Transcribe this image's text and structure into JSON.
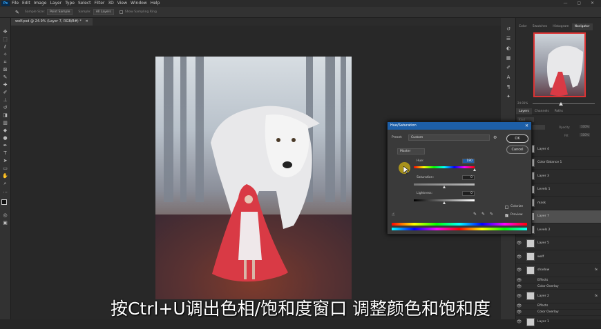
{
  "menubar": {
    "logo": "Ps",
    "items": [
      "File",
      "Edit",
      "Image",
      "Layer",
      "Type",
      "Select",
      "Filter",
      "3D",
      "View",
      "Window",
      "Help"
    ],
    "window_controls": "— ▢ ✕"
  },
  "options_bar": {
    "sample_size_label": "Sample Size:",
    "sample_size_value": "Point Sample",
    "sample_label": "Sample:",
    "sample_value": "All Layers",
    "show_ring": "Show Sampling Ring"
  },
  "document_tab": {
    "title": "wolf.psd @ 24.9% (Layer 7, RGB/8#) *",
    "close": "✕"
  },
  "panel_tabs": [
    "Color",
    "Swatches",
    "Histogram",
    "Navigator"
  ],
  "navigator": {
    "zoom": "24.91%"
  },
  "layers_panel": {
    "tabs": [
      "Layers",
      "Channels",
      "Paths"
    ],
    "kind_label": "Kind",
    "blend_mode": "Normal",
    "opacity_label": "Opacity:",
    "opacity_value": "100%",
    "lock_label": "Lock:",
    "fill_label": "Fill:",
    "fill_value": "100%",
    "layers": [
      {
        "name": "Layer 4",
        "selected": false,
        "fx": false
      },
      {
        "name": "Color Balance 1",
        "selected": false,
        "fx": false
      },
      {
        "name": "Layer 3",
        "selected": false,
        "fx": false
      },
      {
        "name": "Levels 1",
        "selected": false,
        "fx": false
      },
      {
        "name": "mask",
        "selected": false,
        "fx": false
      },
      {
        "name": "Layer 7",
        "selected": true,
        "fx": false
      },
      {
        "name": "Levels 2",
        "selected": false,
        "fx": false
      },
      {
        "name": "Layer 5",
        "selected": false,
        "fx": false
      },
      {
        "name": "wolf",
        "selected": false,
        "fx": false
      },
      {
        "name": "shadow",
        "selected": false,
        "fx": true
      },
      {
        "name": "Effects",
        "selected": false,
        "fx": false
      },
      {
        "name": "Color Overlay",
        "selected": false,
        "fx": false
      },
      {
        "name": "Layer 2",
        "selected": false,
        "fx": true
      },
      {
        "name": "Effects",
        "selected": false,
        "fx": false
      },
      {
        "name": "Color Overlay",
        "selected": false,
        "fx": false
      },
      {
        "name": "Layer 1",
        "selected": false,
        "fx": false
      }
    ]
  },
  "hue_saturation_dialog": {
    "title": "Hue/Saturation",
    "close": "✕",
    "preset_label": "Preset:",
    "preset_value": "Custom",
    "channel_value": "Master",
    "hue_label": "Hue:",
    "hue_value": "180",
    "saturation_label": "Saturation:",
    "saturation_value": "0",
    "lightness_label": "Lightness:",
    "lightness_value": "0",
    "colorize_label": "Colorize",
    "preview_label": "Preview",
    "ok_label": "OK",
    "cancel_label": "Cancel",
    "colorize_checked": false,
    "preview_checked": true
  },
  "subtitle": "按Ctrl+U调出色相/饱和度窗口 调整颜色和饱和度",
  "colors": {
    "dialog_title_bg": "#1d5fa8",
    "cursor_highlight": "#b59c1a",
    "navigator_frame": "#dd3333"
  }
}
